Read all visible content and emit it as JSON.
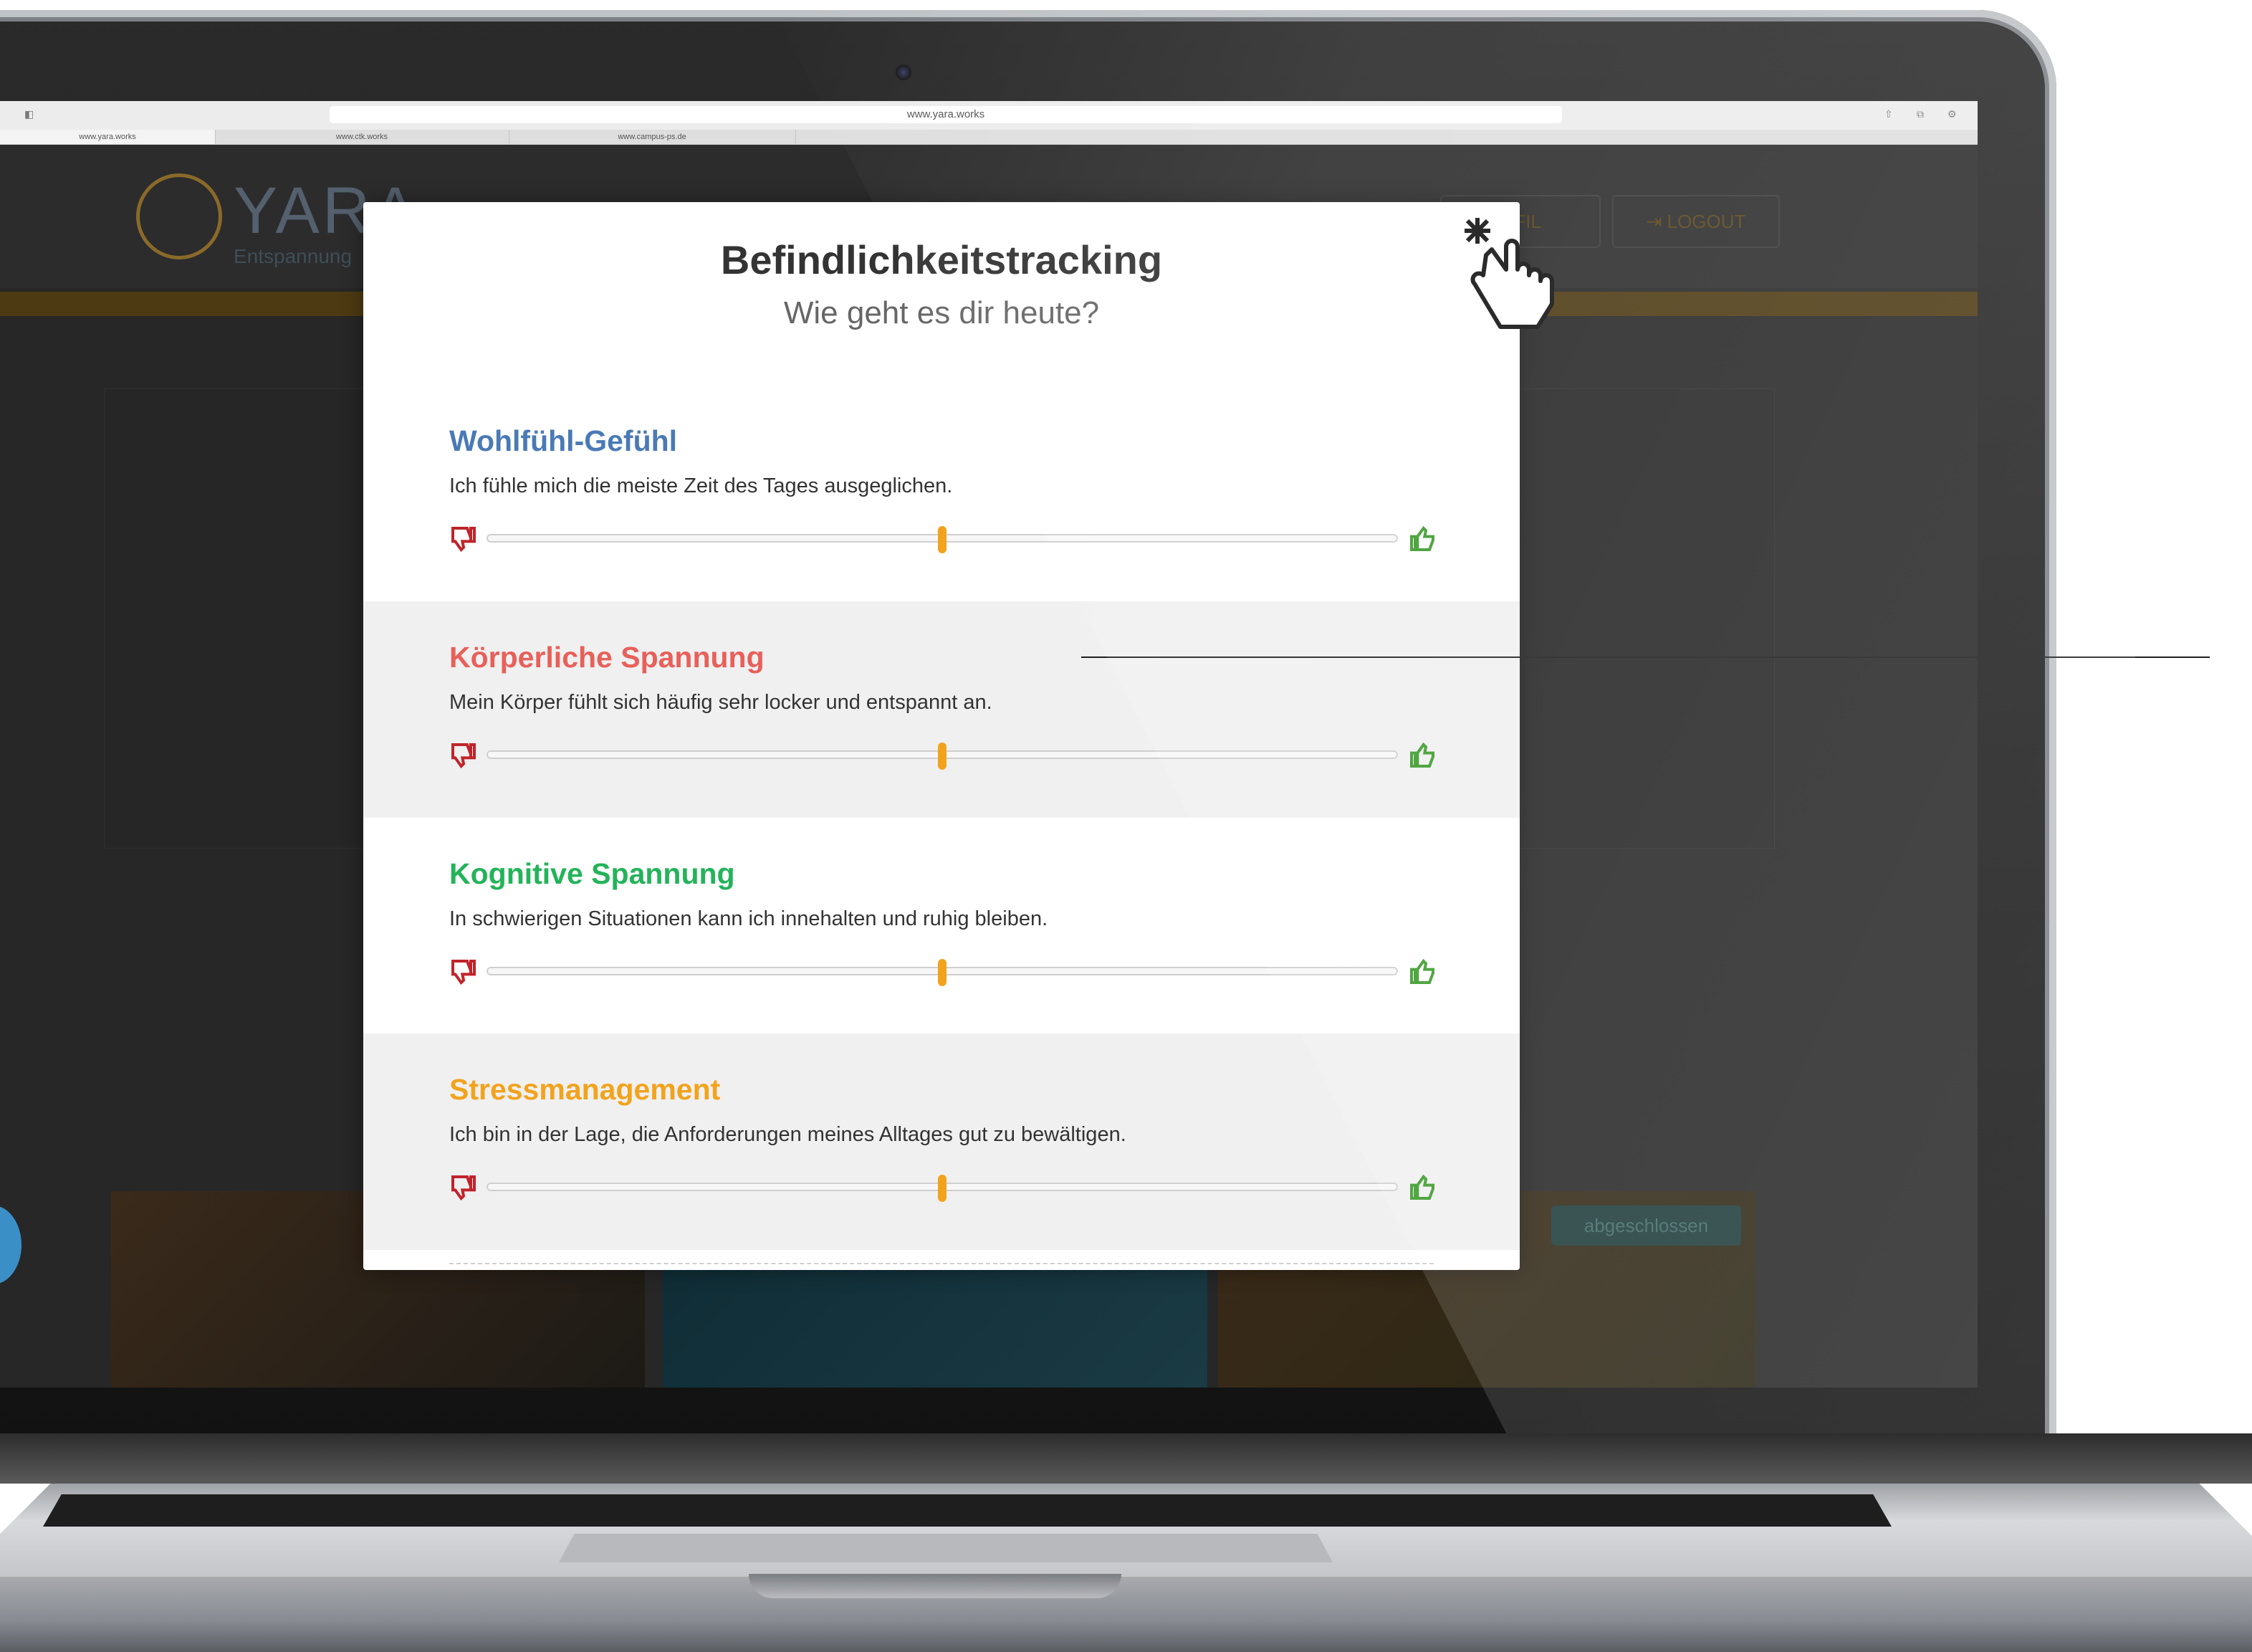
{
  "browser": {
    "url": "www.yara.works",
    "tabs": [
      "www.yara.works",
      "www.ctk.works",
      "www.campus-ps.de"
    ]
  },
  "site": {
    "logo_text": "YARA",
    "logo_sub": "Entspannung",
    "profile_label": "OFIL",
    "logout_label": "LOGOUT",
    "done_label": "abgeschlossen"
  },
  "modal": {
    "title": "Befindlichkeitstracking",
    "subtitle": "Wie geht es dir heute?",
    "sections": [
      {
        "title": "Wohlfühl-Gefühl",
        "text": "Ich fühle mich die meiste Zeit des Tages ausgeglichen.",
        "color": "#4a7ab5",
        "value": 0.5
      },
      {
        "title": "Körperliche Spannung",
        "text": "Mein Körper fühlt sich häufig sehr locker und entspannt an.",
        "color": "#e8605a",
        "value": 0.5
      },
      {
        "title": "Kognitive Spannung",
        "text": "In schwierigen Situationen kann ich innehalten und ruhig bleiben.",
        "color": "#24b35a",
        "value": 0.5
      },
      {
        "title": "Stressmanagement",
        "text": "Ich bin in der Lage, die Anforderungen meines Alltages gut zu bewältigen.",
        "color": "#f2a31d",
        "value": 0.5
      }
    ]
  },
  "colors": {
    "slider_handle": "#f2a31d",
    "thumb_down": "#c0242a",
    "thumb_up": "#3a9a2a"
  },
  "icons": {
    "close": "cursor-hand-icon",
    "negative": "thumbs-down-icon",
    "positive": "thumbs-up-icon"
  }
}
